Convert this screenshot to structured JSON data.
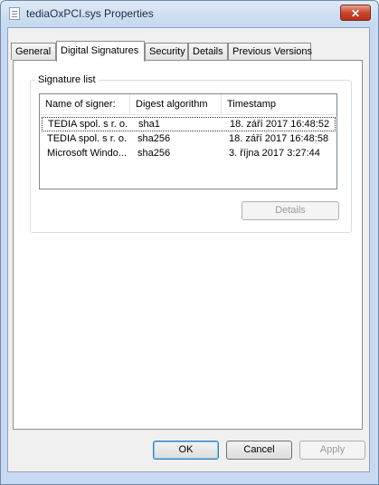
{
  "window": {
    "title": "tediaOxPCI.sys Properties",
    "close_glyph": "✕"
  },
  "tabs": [
    {
      "label": "General"
    },
    {
      "label": "Digital Signatures"
    },
    {
      "label": "Security"
    },
    {
      "label": "Details"
    },
    {
      "label": "Previous Versions"
    }
  ],
  "signature_list": {
    "title": "Signature list",
    "columns": [
      "Name of signer:",
      "Digest algorithm",
      "Timestamp"
    ],
    "rows": [
      {
        "name": "TEDIA spol. s r. o.",
        "algorithm": "sha1",
        "timestamp": "18. září 2017 16:48:52"
      },
      {
        "name": "TEDIA spol. s r. o.",
        "algorithm": "sha256",
        "timestamp": "18. září 2017 16:48:58"
      },
      {
        "name": "Microsoft Windo...",
        "algorithm": "sha256",
        "timestamp": "3. října 2017 3:27:44"
      }
    ]
  },
  "buttons": {
    "details": "Details",
    "ok": "OK",
    "cancel": "Cancel",
    "apply": "Apply"
  }
}
